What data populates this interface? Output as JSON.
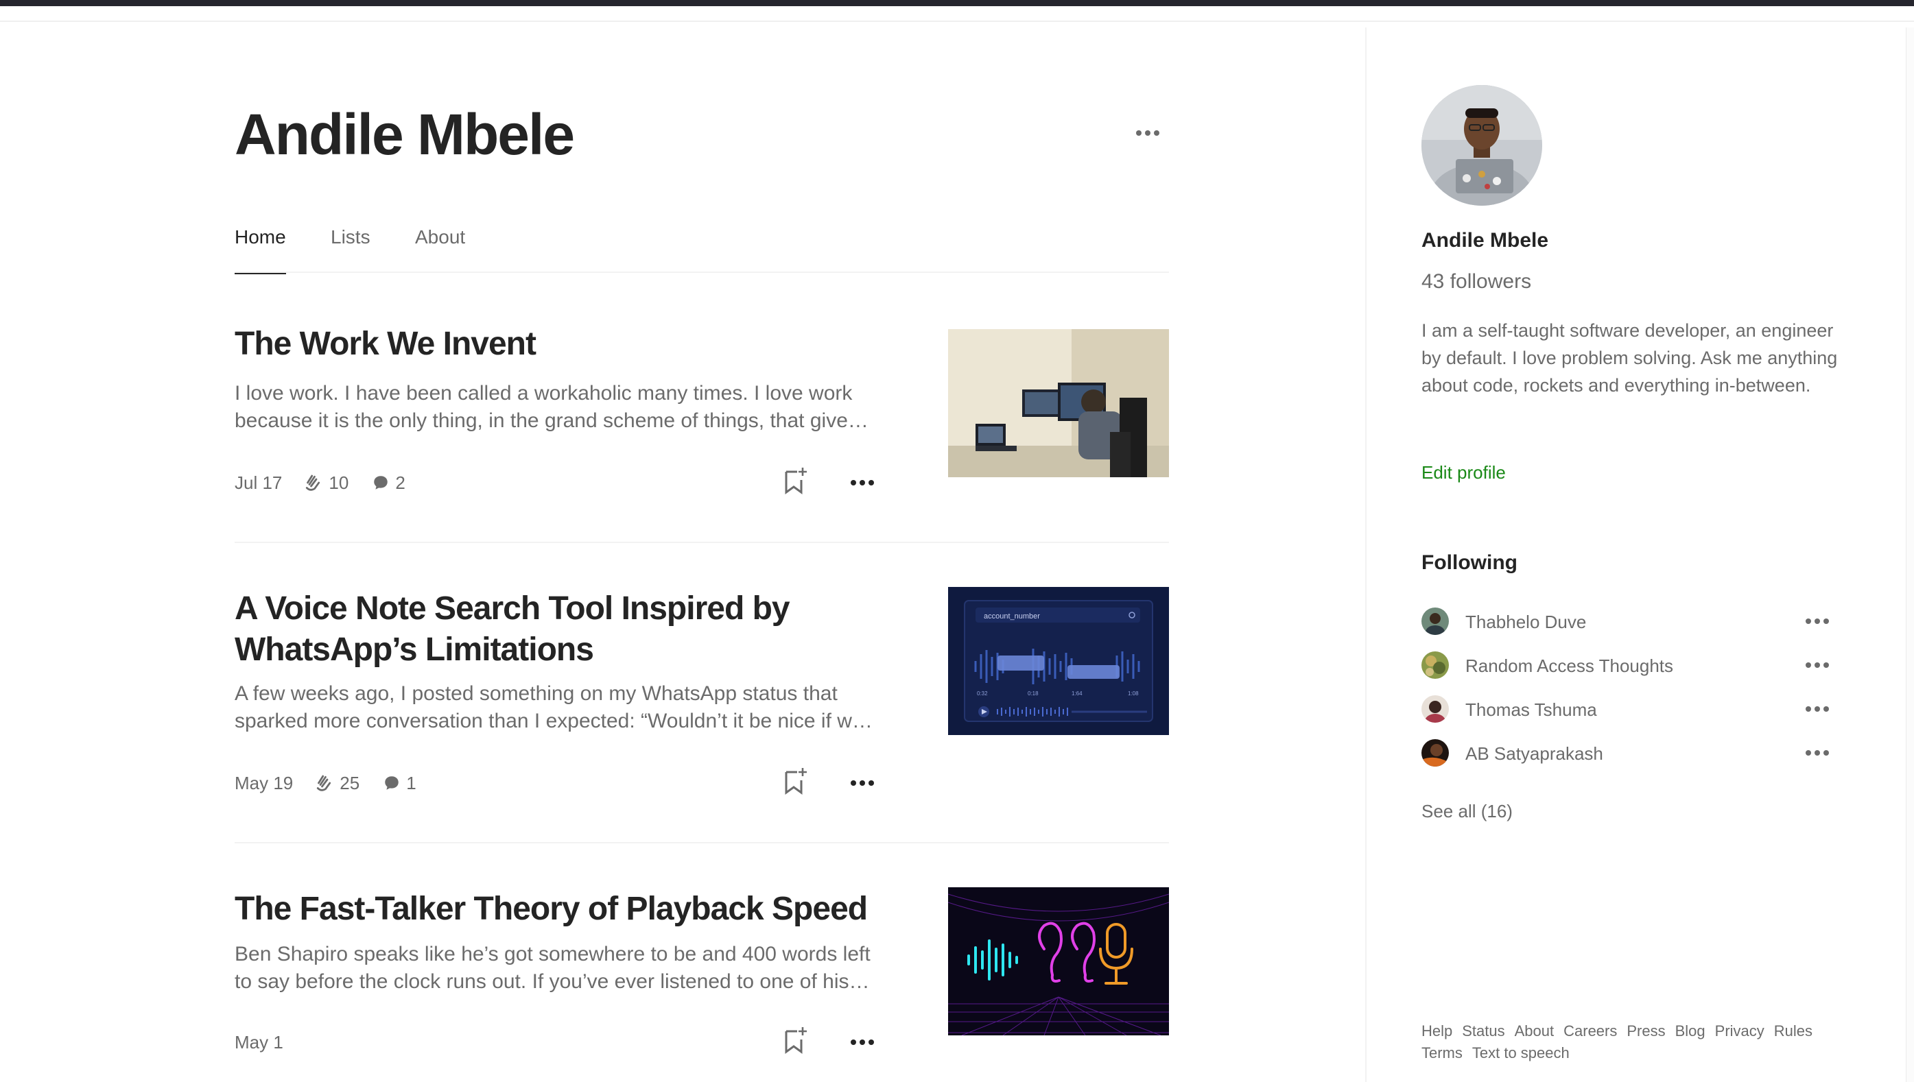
{
  "profile": {
    "name": "Andile Mbele"
  },
  "tabs": [
    {
      "label": "Home",
      "active": true
    },
    {
      "label": "Lists",
      "active": false
    },
    {
      "label": "About",
      "active": false
    }
  ],
  "articles": [
    {
      "title": "The Work We Invent",
      "excerpt": "I love work. I have been called a workaholic many times. I love work because it is the only thing, in the grand scheme of things, that gives me a sense of purpose…",
      "date": "Jul 17",
      "claps": "10",
      "responses": "2",
      "thumbnail": "photo-desk-monitors"
    },
    {
      "title": "A Voice Note Search Tool Inspired by WhatsApp’s Limitations",
      "excerpt": "A few weeks ago, I posted something on my WhatsApp status that sparked more conversation than I expected: “Wouldn’t it be nice if we could search voice notes…",
      "date": "May 19",
      "claps": "25",
      "responses": "1",
      "thumbnail": "waveform-search-ui",
      "thumb_text": "account_number",
      "thumb_times": [
        "0:32",
        "0:18",
        "1:64",
        "1:08"
      ]
    },
    {
      "title": "The Fast-Talker Theory of Playback Speed",
      "excerpt": "Ben Shapiro speaks like he’s got somewhere to be and 400 words left to say before the clock runs out. If you’ve ever listened to one of his debates…",
      "date": "May 1",
      "claps": "",
      "responses": "",
      "thumbnail": "neon-audio-icons"
    }
  ],
  "sidebar": {
    "name": "Andile Mbele",
    "followers": "43 followers",
    "bio": "I am a self-taught software developer, an engineer by default. I love problem solving. Ask me anything about code, rockets and everything in-between.",
    "edit_profile": "Edit profile",
    "following_heading": "Following",
    "following": [
      {
        "name": "Thabhelo Duve",
        "avatar_color": "#4d6b5a"
      },
      {
        "name": "Random Access Thoughts",
        "avatar_color": "#8a9a4a"
      },
      {
        "name": "Thomas Tshuma",
        "avatar_color": "#9a3c4a"
      },
      {
        "name": "AB Satyaprakash",
        "avatar_color": "#3a2a22"
      }
    ],
    "see_all": "See all (16)",
    "footer_links": [
      "Help",
      "Status",
      "About",
      "Careers",
      "Press",
      "Blog",
      "Privacy",
      "Rules",
      "Terms",
      "Text to speech"
    ]
  },
  "colors": {
    "accent_green": "#1a8917",
    "text_primary": "#242424",
    "text_secondary": "#6b6b6b"
  }
}
